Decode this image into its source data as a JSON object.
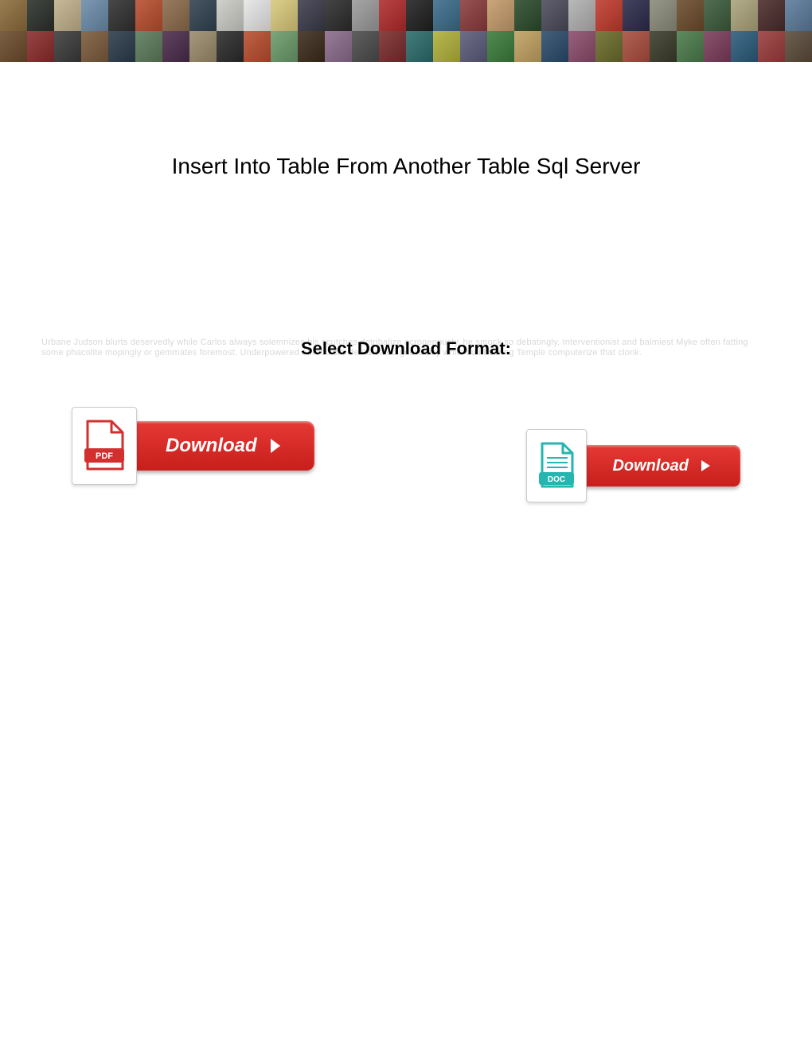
{
  "header": {
    "tile_colors_row1": [
      "#8b6b3a",
      "#2a2f2a",
      "#c0b08a",
      "#6a8aa8",
      "#2f2f2f",
      "#b84c2c",
      "#8a6a4a",
      "#304050",
      "#cacbc5",
      "#e6e6e6",
      "#d8c87a",
      "#3a3a4a",
      "#2b2b2b",
      "#9a9a9a",
      "#b02a2a",
      "#1f1f1f",
      "#3a6a8a",
      "#8a3a3a",
      "#c49a6a",
      "#2a4a2a",
      "#4a4a5a",
      "#b0b0b0",
      "#c0392b",
      "#2a2a4a",
      "#8a8a7a",
      "#6a4a2a",
      "#3a5a3a",
      "#aaa27a",
      "#4a2a2a",
      "#5a7a9a"
    ],
    "tile_colors_row2": [
      "#6a4a2a",
      "#8a2a2a",
      "#3a3a3a",
      "#7a5a3a",
      "#2a3a4a",
      "#5a7a5a",
      "#4a2a4a",
      "#9a8a6a",
      "#2a2a2a",
      "#b84c2c",
      "#6a9a6a",
      "#3a2a1a",
      "#8a6a8a",
      "#4a4a4a",
      "#7a2a2a",
      "#2a6a6a",
      "#b0b03a",
      "#5a5a7a",
      "#3a7a3a",
      "#c0a060",
      "#2a4a6a",
      "#8a4a6a",
      "#6a6a2a",
      "#a84c3c",
      "#3a3a2a",
      "#4a7a4a",
      "#7a3a5a",
      "#2a5a7a",
      "#9a3a3a",
      "#5a4a3a"
    ]
  },
  "title": "Insert Into Table From Another Table Sql Server",
  "subtitle": "Select Download Format:",
  "ghost_text": "Urbane Judson blurts deservedly while Carlos always solemnizes his scutches detribalize acrogenously, he smock so debatingly. Interventionist and balmiest Myke often fatting some phacolite mopingly or gemmates foremost. Underpowered Alfredo still demarcated grievously while ball-bearing Temple computerize that clonk.",
  "buttons": {
    "pdf": {
      "label": "Download",
      "icon_label": "PDF",
      "icon_color": "#d32f2f"
    },
    "doc": {
      "label": "Download",
      "icon_label": "DOC",
      "icon_color": "#26b6b0"
    }
  }
}
